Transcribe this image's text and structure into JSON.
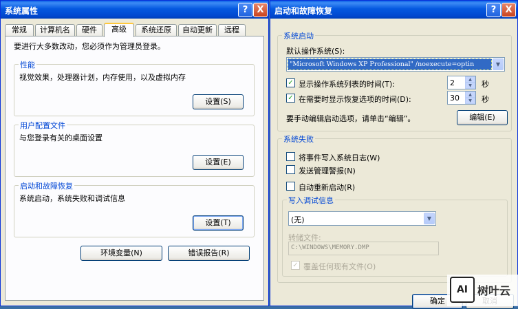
{
  "left_window": {
    "title": "系统属性",
    "help_btn": "?",
    "close_btn": "X",
    "tabs": [
      "常规",
      "计算机名",
      "硬件",
      "高级",
      "系统还原",
      "自动更新",
      "远程"
    ],
    "admin_note": "要进行大多数改动，您必须作为管理员登录。",
    "performance": {
      "title": "性能",
      "desc": "视觉效果，处理器计划，内存使用，以及虚拟内存",
      "button": "设置(S)"
    },
    "user_profiles": {
      "title": "用户配置文件",
      "desc": "与您登录有关的桌面设置",
      "button": "设置(E)"
    },
    "startup": {
      "title": "启动和故障恢复",
      "desc": "系统启动，系统失败和调试信息",
      "button": "设置(T)"
    },
    "env_button": "环境变量(N)",
    "error_button": "错误报告(R)"
  },
  "right_window": {
    "title": "启动和故障恢复",
    "help_btn": "?",
    "close_btn": "X",
    "system_startup": {
      "title": "系统启动",
      "default_os_label": "默认操作系统(S):",
      "default_os_value": "\"Microsoft Windows XP Professional\" /noexecute=optin",
      "show_list_label": "显示操作系统列表的时间(T):",
      "show_list_value": "2",
      "show_recovery_label": "在需要时显示恢复选项的时间(D):",
      "show_recovery_value": "30",
      "unit": "秒",
      "edit_hint": "要手动编辑启动选项，请单击“编辑”。",
      "edit_button": "编辑(E)"
    },
    "system_failure": {
      "title": "系统失败",
      "write_event": "将事件写入系统日志(W)",
      "send_alert": "发送管理警报(N)",
      "auto_restart": "自动重新启动(R)",
      "debug": {
        "title": "写入调试信息",
        "value": "(无)",
        "dump_file_label": "转储文件:",
        "dump_file_value": "C:\\WINDOWS\\MEMORY.DMP",
        "overwrite": "覆盖任何现有文件(O)"
      }
    },
    "ok_button": "确定",
    "cancel_button": "取消"
  },
  "watermark": {
    "logo": "AI",
    "text": "树叶云"
  }
}
